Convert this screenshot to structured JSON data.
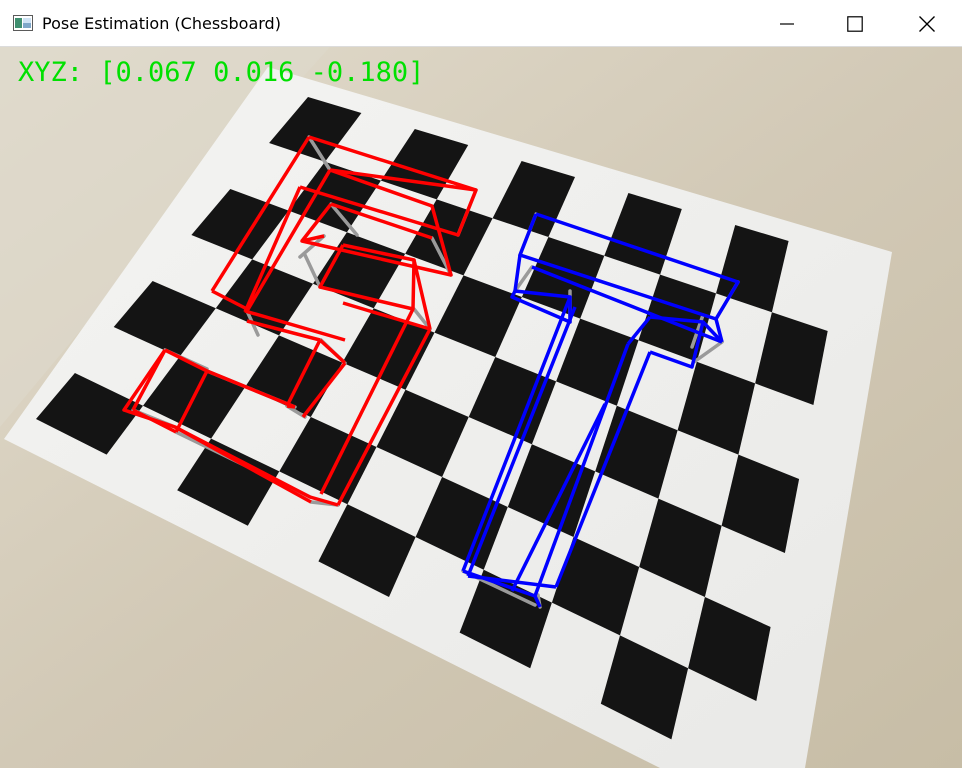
{
  "window": {
    "title": "Pose Estimation (Chessboard)",
    "icon": "app-window-icon",
    "controls": {
      "minimize_icon": "minimize-icon",
      "maximize_icon": "maximize-icon",
      "close_icon": "close-icon"
    }
  },
  "overlay": {
    "position_label": "XYZ: [0.067 0.016 -0.180]",
    "position_text_color": "#00e000"
  },
  "scene": {
    "description_color_paper": "#f3f3f3",
    "board_color": "#141414",
    "table_color": "#cfc6b4",
    "letter_s_color": "#ff0000",
    "letter_t_color": "#0000ff",
    "edge_color": "#9a9a9a"
  }
}
